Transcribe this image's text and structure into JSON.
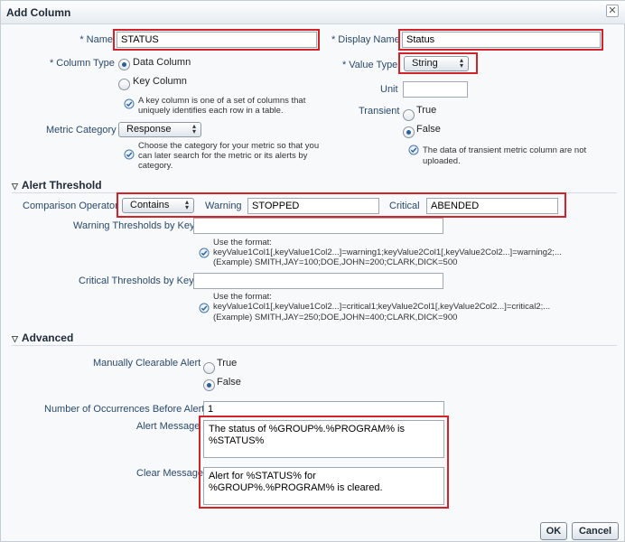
{
  "dialog": {
    "title": "Add Column",
    "close_icon": "✕"
  },
  "general": {
    "name_label": "Name",
    "name_value": "STATUS",
    "display_name_label": "Display Name",
    "display_name_value": "Status",
    "column_type_label": "Column Type",
    "column_type_options": [
      "Data Column",
      "Key Column"
    ],
    "key_column_help_line1": "A key column is one of a set of columns that",
    "key_column_help_line2": "uniquely identifies each row in a table.",
    "value_type_label": "Value Type",
    "value_type_value": "String",
    "unit_label": "Unit",
    "unit_value": "",
    "transient_label": "Transient",
    "transient_options": [
      "True",
      "False"
    ],
    "transient_help": "The data of transient metric column are not uploaded.",
    "metric_category_label": "Metric Category",
    "metric_category_value": "Response",
    "metric_category_help_line1": "Choose the category for your metric so that you",
    "metric_category_help_line2": "can later search for the metric or its alerts by",
    "metric_category_help_line3": "category."
  },
  "alert": {
    "section_title": "Alert Threshold",
    "comparison_label": "Comparison Operator",
    "comparison_value": "Contains",
    "warning_label": "Warning",
    "warning_value": "STOPPED",
    "critical_label": "Critical",
    "critical_value": "ABENDED",
    "warning_by_key_label": "Warning Thresholds by Key",
    "warning_by_key_value": "",
    "warning_help_line1": "Use the format:",
    "warning_help_line2": "keyValue1Col1[,keyValue1Col2...]=warning1;keyValue2Col1[,keyValue2Col2...]=warning2;...",
    "warning_help_line3": "(Example) SMITH,JAY=100;DOE,JOHN=200;CLARK,DICK=500",
    "critical_by_key_label": "Critical Thresholds by Key",
    "critical_by_key_value": "",
    "critical_help_line1": "Use the format:",
    "critical_help_line2": "keyValue1Col1[,keyValue1Col2...]=critical1;keyValue2Col1[,keyValue2Col2...]=critical2;...",
    "critical_help_line3": "(Example) SMITH,JAY=250;DOE,JOHN=400;CLARK,DICK=900"
  },
  "advanced": {
    "section_title": "Advanced",
    "clearable_label": "Manually Clearable Alert",
    "clearable_options": [
      "True",
      "False"
    ],
    "occurrences_label": "Number of Occurrences Before Alert",
    "occurrences_value": "1",
    "alert_message_label": "Alert Message",
    "alert_message_value": "The status of %GROUP%.%PROGRAM% is %STATUS%",
    "clear_message_label": "Clear Message",
    "clear_message_value": "Alert for %STATUS% for %GROUP%.%PROGRAM% is cleared."
  },
  "footer": {
    "ok_label": "OK",
    "cancel_label": "Cancel"
  },
  "colors": {
    "highlight": "#d2232a",
    "label": "#2a4a6b",
    "radio_selected": "#2b5f98"
  }
}
